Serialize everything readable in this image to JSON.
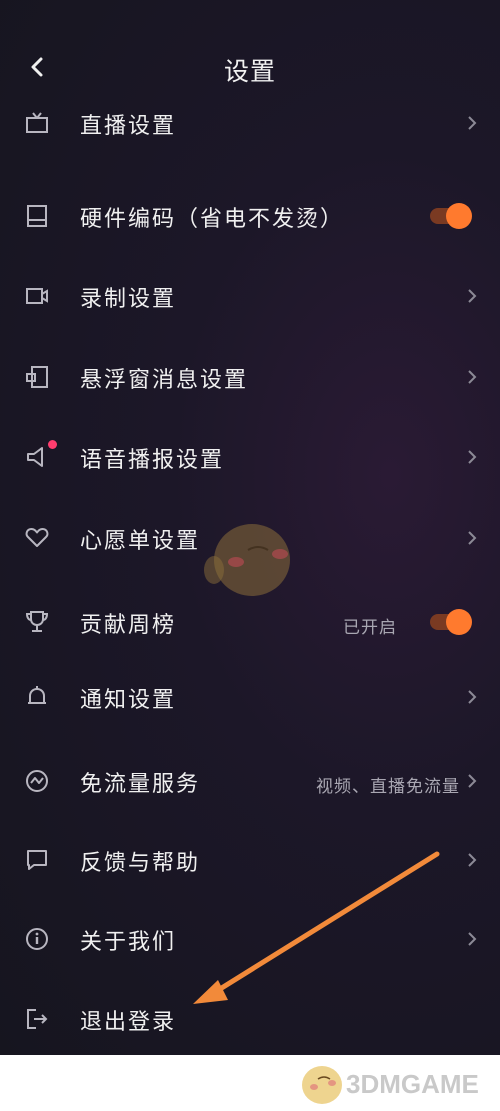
{
  "header": {
    "title": "设置"
  },
  "items": [
    {
      "label": "直播设置",
      "icon": "tv-icon"
    },
    {
      "label": "硬件编码（省电不发烫）",
      "icon": "chip-icon",
      "toggle_on": true
    },
    {
      "label": "录制设置",
      "icon": "video-camera-icon"
    },
    {
      "label": "悬浮窗消息设置",
      "icon": "floating-window-icon"
    },
    {
      "label": "语音播报设置",
      "icon": "speaker-icon",
      "badge_dot": true
    },
    {
      "label": "心愿单设置",
      "icon": "heart-icon"
    },
    {
      "label": "贡献周榜",
      "icon": "trophy-icon",
      "value": "已开启",
      "toggle_on": true
    },
    {
      "label": "通知设置",
      "icon": "bell-icon"
    },
    {
      "label": "免流量服务",
      "icon": "data-flow-icon",
      "value": "视频、直播免流量"
    },
    {
      "label": "反馈与帮助",
      "icon": "message-icon"
    },
    {
      "label": "关于我们",
      "icon": "info-icon"
    },
    {
      "label": "退出登录",
      "icon": "logout-icon"
    }
  ],
  "colors": {
    "accent": "#ff7a2e",
    "annotation_arrow": "#f28a3a",
    "background": "#16151f"
  },
  "watermark": {
    "text": "3DMGAME"
  }
}
